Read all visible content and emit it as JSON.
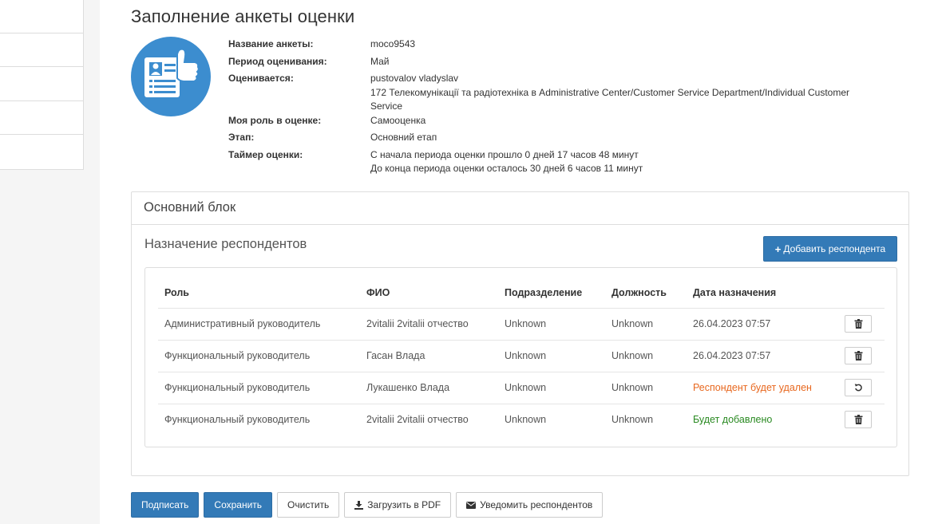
{
  "page": {
    "title": "Заполнение анкеты оценки"
  },
  "info": [
    {
      "label": "Название анкеты:",
      "value": "moco9543"
    },
    {
      "label": "Период оценивания:",
      "value": "Май"
    },
    {
      "label": "Оценивается:",
      "value": "pustovalov vladyslav",
      "value2": "172 Телекомунікації та радіотехніка в Administrative Center/Customer Service Department/Individual Customer Service"
    },
    {
      "label": "Моя роль в оценке:",
      "value": "Самооценка"
    },
    {
      "label": "Этап:",
      "value": "Основний етап"
    },
    {
      "label": "Таймер оценки:",
      "value": "С начала периода оценки прошло 0 дней 17 часов 48 минут",
      "value2": "До конца периода оценки осталось 30 дней 6 часов 11 минут"
    }
  ],
  "panel": {
    "heading": "Основний блок",
    "section_title": "Назначение респондентов",
    "add_button": "Добавить респондента"
  },
  "table": {
    "headers": [
      "Роль",
      "ФИО",
      "Подразделение",
      "Должность",
      "Дата назначения"
    ],
    "rows": [
      {
        "role": "Административный руководитель",
        "fio": "2vitalii 2vitalii отчество",
        "dept": "Unknown",
        "position": "Unknown",
        "date": "26.04.2023 07:57",
        "action": "delete-icon"
      },
      {
        "role": "Функциональный руководитель",
        "fio": "Гасан Влада",
        "dept": "Unknown",
        "position": "Unknown",
        "date": "26.04.2023 07:57",
        "action": "delete-icon"
      },
      {
        "role": "Функциональный руководитель",
        "fio": "Лукашенко Влада",
        "dept": "Unknown",
        "position": "Unknown",
        "date": "Респондент будет удален",
        "action": "undo-icon"
      },
      {
        "role": "Функциональный руководитель",
        "fio": "2vitalii 2vitalii отчество",
        "dept": "Unknown",
        "position": "Unknown",
        "date": "Будет добавлено",
        "action": "delete-icon"
      }
    ]
  },
  "footer": {
    "sign": "Подписать",
    "save": "Сохранить",
    "clear": "Очистить",
    "pdf": "Загрузить в PDF",
    "notify": "Уведомить респондентов"
  },
  "colors": {
    "primary": "#337ab7",
    "logo": "#3c8dcf",
    "status_removed": "#e8681f",
    "status_added": "#2a8a22"
  }
}
